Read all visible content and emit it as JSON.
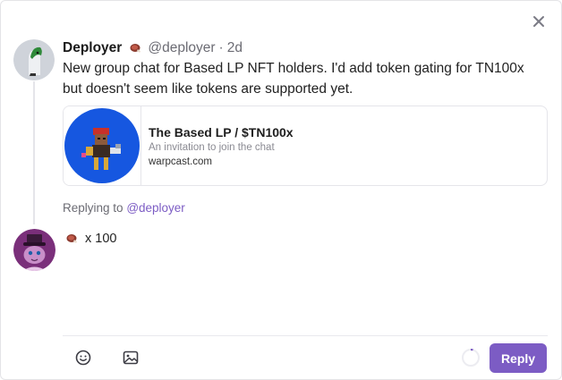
{
  "post": {
    "author_name": "Deployer",
    "author_handle": "@deployer",
    "separator": "·",
    "time": "2d",
    "text": "New group chat for Based LP NFT holders. I'd add token gating for TN100x but doesn't seem like tokens are supported yet.",
    "author_emoji_icon": "ham-icon"
  },
  "embed": {
    "title": "The Based LP / $TN100x",
    "description": "An invitation to join the chat",
    "domain": "warpcast.com"
  },
  "replying": {
    "prefix": "Replying to",
    "handle": "@deployer"
  },
  "composer": {
    "text": "x 100",
    "emoji_icon": "ham-icon",
    "reply_label": "Reply"
  },
  "colors": {
    "accent": "#7c5cc4",
    "embed_image_bg": "#1657e0"
  }
}
